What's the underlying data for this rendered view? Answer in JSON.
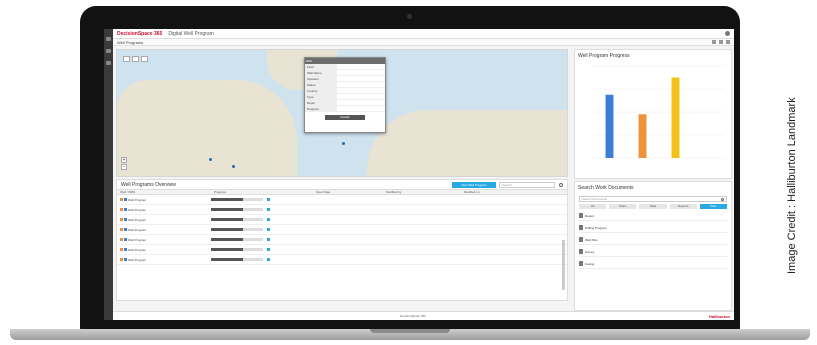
{
  "credit": "Image Credit : Halliburton Landmark",
  "app": {
    "brand": "DecisionSpace 365",
    "title": "Digital Well Program"
  },
  "subbar": {
    "label": "Well Programs"
  },
  "map_popup": {
    "header": "Well",
    "rows": [
      {
        "k": "Field",
        "v": ""
      },
      {
        "k": "Well Name",
        "v": ""
      },
      {
        "k": "Operator",
        "v": ""
      },
      {
        "k": "Status",
        "v": ""
      },
      {
        "k": "Country",
        "v": ""
      },
      {
        "k": "Type",
        "v": ""
      },
      {
        "k": "Depth",
        "v": ""
      },
      {
        "k": "Progress",
        "v": ""
      }
    ],
    "button": "Details"
  },
  "chart_panel": {
    "title": "Well Program Progress"
  },
  "chart_data": {
    "type": "bar",
    "categories": [
      "",
      "",
      "",
      ""
    ],
    "series": [
      {
        "values": [
          55,
          38,
          70,
          0
        ]
      }
    ],
    "colors": [
      "#3a7fd5",
      "#f0923a",
      "#f2c21a",
      "#c8c8c8"
    ],
    "ylim": [
      0,
      80
    ]
  },
  "search_panel": {
    "title": "Search Work Documents",
    "placeholder": "Search documents",
    "filters": [
      "All",
      "Plans",
      "Data",
      "Reports",
      "Files"
    ],
    "results": [
      {
        "text": "Report",
        "date": ""
      },
      {
        "text": "Drilling Program",
        "date": ""
      },
      {
        "text": "Well Plan",
        "date": ""
      },
      {
        "text": "Survey",
        "date": ""
      },
      {
        "text": "Casing",
        "date": ""
      }
    ]
  },
  "table_panel": {
    "title": "Well Programs Overview",
    "new_button": "New Well Program",
    "search_placeholder": "Search",
    "columns": [
      "Well / WBS",
      "Progress",
      "Spud Date",
      "Modified by",
      "Modified on"
    ],
    "rows": [
      {
        "name": "Well Program",
        "progress": 0.62
      },
      {
        "name": "Well Program",
        "progress": 0.62
      },
      {
        "name": "Well Program",
        "progress": 0.62
      },
      {
        "name": "Well Program",
        "progress": 0.62
      },
      {
        "name": "Well Program",
        "progress": 0.62
      },
      {
        "name": "Well Program",
        "progress": 0.62
      },
      {
        "name": "Well Program",
        "progress": 0.62
      }
    ]
  },
  "footer": {
    "center": "DecisionSpace 365",
    "brand": "Halliburton"
  }
}
